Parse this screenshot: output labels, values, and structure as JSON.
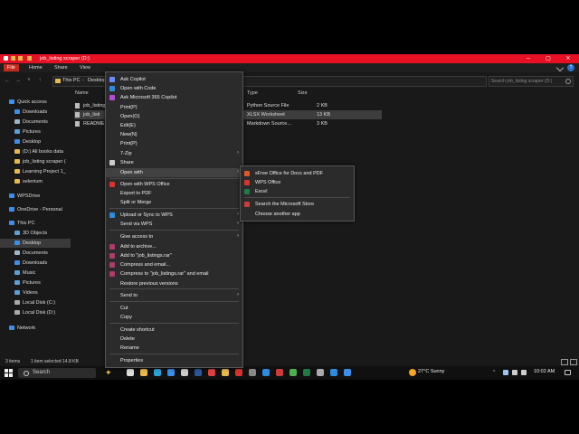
{
  "window": {
    "title": "job_listing scraper (D:)",
    "buttons": {
      "minimize": "─",
      "maximize": "▢",
      "close": "✕"
    }
  },
  "ribbon": {
    "tabs": [
      "File",
      "Home",
      "Share",
      "View"
    ],
    "help": "?"
  },
  "address": {
    "path": [
      "This PC",
      "Desktop"
    ],
    "search_placeholder": "Search job_listing scraper (D:)"
  },
  "nav_pane": {
    "items": [
      {
        "label": "Quick access",
        "icon": "star-icon",
        "color": "#3b8eea"
      },
      {
        "label": "Downloads",
        "icon": "download-icon",
        "color": "#3b8eea"
      },
      {
        "label": "Documents",
        "icon": "document-icon",
        "color": "#9fb6c8"
      },
      {
        "label": "Pictures",
        "icon": "pictures-icon",
        "color": "#5aa0d8"
      },
      {
        "label": "Desktop",
        "icon": "desktop-icon",
        "color": "#3b8eea"
      },
      {
        "label": "(D:) All books data",
        "icon": "folder-icon",
        "color": "#e8b84a"
      },
      {
        "label": "job_listing scraper (",
        "icon": "folder-icon",
        "color": "#e8b84a"
      },
      {
        "label": "Learning Project 1_",
        "icon": "folder-icon",
        "color": "#e8b84a"
      },
      {
        "label": "selenium",
        "icon": "folder-icon",
        "color": "#e8b84a"
      },
      {
        "label": "WPSDrive",
        "icon": "cloud-icon",
        "color": "#3b8eea"
      },
      {
        "label": "OneDrive - Personal",
        "icon": "cloud-icon",
        "color": "#3b8eea"
      },
      {
        "label": "This PC",
        "icon": "pc-icon",
        "color": "#3b8eea"
      },
      {
        "label": "3D Objects",
        "icon": "cube-icon",
        "color": "#5aa0d8"
      },
      {
        "label": "Desktop",
        "icon": "desktop-icon",
        "color": "#3b8eea"
      },
      {
        "label": "Documents",
        "icon": "document-icon",
        "color": "#9fb6c8"
      },
      {
        "label": "Downloads",
        "icon": "download-icon",
        "color": "#3b8eea"
      },
      {
        "label": "Music",
        "icon": "music-icon",
        "color": "#5aa0d8"
      },
      {
        "label": "Pictures",
        "icon": "pictures-icon",
        "color": "#5aa0d8"
      },
      {
        "label": "Videos",
        "icon": "video-icon",
        "color": "#5aa0d8"
      },
      {
        "label": "Local Disk (C:)",
        "icon": "drive-icon",
        "color": "#aaaaaa"
      },
      {
        "label": "Local Disk (D:)",
        "icon": "drive-icon",
        "color": "#aaaaaa"
      },
      {
        "label": "Network",
        "icon": "network-icon",
        "color": "#3b8eea"
      }
    ]
  },
  "file_list": {
    "columns": {
      "name": "Name",
      "type": "Type",
      "size": "Size"
    },
    "rows": [
      {
        "name": "job_listing",
        "type": "Python Source File",
        "size": "2 KB",
        "selected": false
      },
      {
        "name": "job_listi",
        "type": "XLSX Worksheet",
        "size": "13 KB",
        "selected": true
      },
      {
        "name": "README",
        "type": "Markdown Source...",
        "size": "3 KB",
        "selected": false
      }
    ]
  },
  "status": {
    "items": "3 items",
    "selected": "1 item selected  14.8 KB"
  },
  "context_menu": {
    "items": [
      {
        "label": "Ask Copilot",
        "icon": "copilot-icon",
        "color": "#6a8cff"
      },
      {
        "label": "Open with Code",
        "icon": "vscode-icon",
        "color": "#2a8de0"
      },
      {
        "label": "Ask Microsoft 365 Copilot",
        "icon": "m365-icon",
        "color": "#b44cd6"
      },
      {
        "label": "Print(P)",
        "icon": "",
        "color": ""
      },
      {
        "label": "Open(O)",
        "icon": "",
        "color": ""
      },
      {
        "label": "Edit(E)",
        "icon": "",
        "color": ""
      },
      {
        "label": "New(N)",
        "icon": "",
        "color": ""
      },
      {
        "label": "Print(P)",
        "icon": "",
        "color": ""
      },
      {
        "label": "7-Zip",
        "icon": "",
        "color": "",
        "submenu": true
      },
      {
        "label": "Share",
        "icon": "share-icon",
        "color": "#cccccc"
      },
      {
        "label": "Open with",
        "icon": "",
        "color": "",
        "submenu": true,
        "highlight": true
      },
      {
        "label": "Open with WPS Office",
        "icon": "wps-icon",
        "color": "#d9342b"
      },
      {
        "label": "Export to PDF",
        "icon": "",
        "color": ""
      },
      {
        "label": "Split or Merge",
        "icon": "",
        "color": ""
      },
      {
        "label": "Upload or Sync to WPS",
        "icon": "wps-cloud-icon",
        "color": "#2a8de0",
        "submenu": true
      },
      {
        "label": "Send via WPS",
        "icon": "",
        "color": "",
        "submenu": true
      },
      {
        "label": "Give access to",
        "icon": "",
        "color": "",
        "submenu": true
      },
      {
        "label": "Add to archive...",
        "icon": "winrar-icon",
        "color": "#b03a6a"
      },
      {
        "label": "Add to \"job_listings.rar\"",
        "icon": "winrar-icon",
        "color": "#b03a6a"
      },
      {
        "label": "Compress and email...",
        "icon": "winrar-icon",
        "color": "#b03a6a"
      },
      {
        "label": "Compress to \"job_listings.rar\" and email",
        "icon": "winrar-icon",
        "color": "#b03a6a"
      },
      {
        "label": "Restore previous versions",
        "icon": "",
        "color": ""
      },
      {
        "label": "Send to",
        "icon": "",
        "color": "",
        "submenu": true
      },
      {
        "label": "Cut",
        "icon": "",
        "color": ""
      },
      {
        "label": "Copy",
        "icon": "",
        "color": ""
      },
      {
        "label": "Create shortcut",
        "icon": "",
        "color": ""
      },
      {
        "label": "Delete",
        "icon": "",
        "color": ""
      },
      {
        "label": "Rename",
        "icon": "",
        "color": ""
      },
      {
        "label": "Properties",
        "icon": "",
        "color": ""
      }
    ]
  },
  "open_with_menu": {
    "items": [
      {
        "label": "sFree Office for Docs and PDF",
        "icon": "free-office-icon",
        "color": "#e2552b"
      },
      {
        "label": "WPS Office",
        "icon": "wps-icon",
        "color": "#d9342b"
      },
      {
        "label": "Excel",
        "icon": "excel-icon",
        "color": "#1f7a43"
      },
      {
        "label": "Search the Microsoft Store",
        "icon": "store-icon",
        "color": "#cc3a3a"
      },
      {
        "label": "Choose another app",
        "icon": "",
        "color": ""
      }
    ]
  },
  "taskbar": {
    "search_label": "Search",
    "weather": "27°C  Sunny",
    "time": "10:02 AM",
    "apps": [
      {
        "icon": "task-view-icon",
        "color": "#dddddd"
      },
      {
        "icon": "file-explorer-icon",
        "color": "#e8b84a"
      },
      {
        "icon": "edge-icon",
        "color": "#2aa1d8"
      },
      {
        "icon": "mail-icon",
        "color": "#3b8eea"
      },
      {
        "icon": "store-icon",
        "color": "#cccccc"
      },
      {
        "icon": "word-icon",
        "color": "#2b579a"
      },
      {
        "icon": "media-icon",
        "color": "#e04040"
      },
      {
        "icon": "chrome-icon",
        "color": "#e8b84a"
      },
      {
        "icon": "app-icon",
        "color": "#d9342b"
      },
      {
        "icon": "settings-icon",
        "color": "#888888"
      },
      {
        "icon": "vscode-icon",
        "color": "#2a8de0"
      },
      {
        "icon": "app-icon",
        "color": "#cc3a3a"
      },
      {
        "icon": "chrome-icon",
        "color": "#4caf50"
      },
      {
        "icon": "excel-icon",
        "color": "#1f7a43"
      },
      {
        "icon": "app-icon",
        "color": "#aaaaaa"
      },
      {
        "icon": "vscode-icon",
        "color": "#2a8de0"
      },
      {
        "icon": "python-icon",
        "color": "#3b8eea"
      }
    ]
  },
  "colors": {
    "accent": "#e81123",
    "menu_bg": "#2b2b2b",
    "background": "#191919"
  }
}
